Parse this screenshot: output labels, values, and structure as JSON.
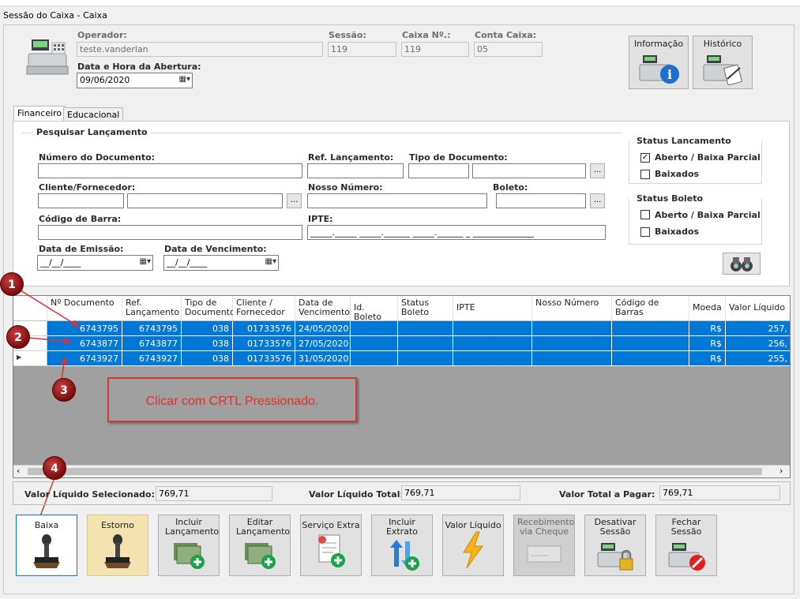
{
  "window": {
    "title": "Sessão do Caixa - Caixa"
  },
  "header": {
    "operador_label": "Operador:",
    "operador_value": "teste.vanderlan",
    "sessao_label": "Sessão:",
    "sessao_value": "119",
    "caixa_label": "Caixa Nº.:",
    "caixa_value": "119",
    "conta_label": "Conta Caixa:",
    "conta_value": "05",
    "abertura_label": "Data e Hora da Abertura:",
    "abertura_value": "09/06/2020",
    "info_button": "Informação",
    "historico_button": "Histórico"
  },
  "tabs": [
    {
      "label": "Financeiro"
    },
    {
      "label": "Educacional"
    }
  ],
  "search": {
    "group_label": "Pesquisar Lançamento",
    "numero_doc_label": "Número do Documento:",
    "ref_lanc_label": "Ref. Lançamento:",
    "tipo_doc_label": "Tipo de Documento:",
    "cliente_label": "Cliente/Fornecedor:",
    "nosso_numero_label": "Nosso Número:",
    "boleto_label": "Boleto:",
    "codigo_barra_label": "Código de Barra:",
    "ipte_label": "IPTE:",
    "ipte_mask": "_____._____ _____.______ _____.______ _ ______________",
    "emissao_label": "Data de Emissão:",
    "emissao_value": "__/__/____",
    "vencimento_label": "Data de Vencimento:",
    "vencimento_value": "__/__/____",
    "dots": "..."
  },
  "status_lancamento": {
    "title": "Status Lancamento",
    "items": [
      {
        "label": "Aberto / Baixa Parcial",
        "checked": true
      },
      {
        "label": "Baixados",
        "checked": false
      }
    ]
  },
  "status_boleto": {
    "title": "Status Boleto",
    "items": [
      {
        "label": "Aberto / Baixa Parcial",
        "checked": false
      },
      {
        "label": "Baixados",
        "checked": false
      }
    ]
  },
  "grid": {
    "headers": [
      "Nº Documento",
      "Ref. Lançamento",
      "Tipo de Documento",
      "Cliente / Fornecedor",
      "Data de Vencimento",
      "Id. Boleto",
      "Status Boleto",
      "IPTE",
      "Nosso Número",
      "Código de Barras",
      "Moeda",
      "Valor Líquido"
    ],
    "rows": [
      [
        "6743795",
        "6743795",
        "038",
        "01733576",
        "24/05/2020",
        "",
        "",
        "",
        "",
        "",
        "R$",
        "257,"
      ],
      [
        "6743877",
        "6743877",
        "038",
        "01733576",
        "27/05/2020",
        "",
        "",
        "",
        "",
        "",
        "R$",
        "256,"
      ],
      [
        "6743927",
        "6743927",
        "038",
        "01733576",
        "31/05/2020",
        "",
        "",
        "",
        "",
        "",
        "R$",
        "255,"
      ]
    ],
    "current_row_marker": "▶"
  },
  "annotation": {
    "text": "Clicar com CRTL Pressionado.",
    "markers": [
      "1",
      "2",
      "3",
      "4"
    ],
    "color": "#c0302a"
  },
  "totals": {
    "selecionado_label": "Valor Líquido Selecionado:",
    "selecionado_value": "769,71",
    "total_label": "Valor Líquido Total:",
    "total_value": "769,71",
    "pagar_label": "Valor Total a Pagar:",
    "pagar_value": "769,71"
  },
  "actions": [
    {
      "label": "Baixa"
    },
    {
      "label": "Estorno"
    },
    {
      "label": "Incluir Lançamento"
    },
    {
      "label": "Editar Lançamento"
    },
    {
      "label": "Serviço Extra"
    },
    {
      "label": "Incluir Extrato"
    },
    {
      "label": "Valor Líquido"
    },
    {
      "label": "Recebimento via Cheque"
    },
    {
      "label": "Desativar Sessão"
    },
    {
      "label": "Fechar Sessão"
    }
  ],
  "colors": {
    "selection": "#0078d7",
    "grid_bg": "#a0a0a0",
    "annotation": "#d33"
  }
}
